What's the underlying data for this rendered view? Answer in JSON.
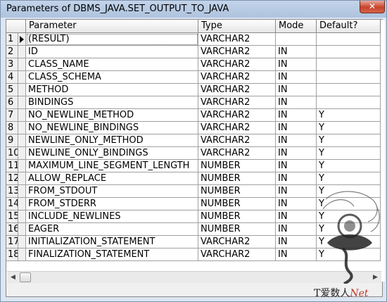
{
  "window": {
    "title": "Parameters of DBMS_JAVA.SET_OUTPUT_TO_JAVA",
    "close_glyph": "✕"
  },
  "grid": {
    "headers": [
      "Parameter",
      "Type",
      "Mode",
      "Default?"
    ],
    "rows": [
      {
        "num": "1",
        "parameter": "(RESULT)",
        "type": "VARCHAR2",
        "mode": "",
        "default": ""
      },
      {
        "num": "2",
        "parameter": "ID",
        "type": "VARCHAR2",
        "mode": "IN",
        "default": ""
      },
      {
        "num": "3",
        "parameter": "CLASS_NAME",
        "type": "VARCHAR2",
        "mode": "IN",
        "default": ""
      },
      {
        "num": "4",
        "parameter": "CLASS_SCHEMA",
        "type": "VARCHAR2",
        "mode": "IN",
        "default": ""
      },
      {
        "num": "5",
        "parameter": "METHOD",
        "type": "VARCHAR2",
        "mode": "IN",
        "default": ""
      },
      {
        "num": "6",
        "parameter": "BINDINGS",
        "type": "VARCHAR2",
        "mode": "IN",
        "default": ""
      },
      {
        "num": "7",
        "parameter": "NO_NEWLINE_METHOD",
        "type": "VARCHAR2",
        "mode": "IN",
        "default": "Y"
      },
      {
        "num": "8",
        "parameter": "NO_NEWLINE_BINDINGS",
        "type": "VARCHAR2",
        "mode": "IN",
        "default": "Y"
      },
      {
        "num": "9",
        "parameter": "NEWLINE_ONLY_METHOD",
        "type": "VARCHAR2",
        "mode": "IN",
        "default": "Y"
      },
      {
        "num": "10",
        "parameter": "NEWLINE_ONLY_BINDINGS",
        "type": "VARCHAR2",
        "mode": "IN",
        "default": "Y"
      },
      {
        "num": "11",
        "parameter": "MAXIMUM_LINE_SEGMENT_LENGTH",
        "type": "NUMBER",
        "mode": "IN",
        "default": "Y"
      },
      {
        "num": "12",
        "parameter": "ALLOW_REPLACE",
        "type": "NUMBER",
        "mode": "IN",
        "default": "Y"
      },
      {
        "num": "13",
        "parameter": "FROM_STDOUT",
        "type": "NUMBER",
        "mode": "IN",
        "default": "Y"
      },
      {
        "num": "14",
        "parameter": "FROM_STDERR",
        "type": "NUMBER",
        "mode": "IN",
        "default": "Y"
      },
      {
        "num": "15",
        "parameter": "INCLUDE_NEWLINES",
        "type": "NUMBER",
        "mode": "IN",
        "default": "Y"
      },
      {
        "num": "16",
        "parameter": "EAGER",
        "type": "NUMBER",
        "mode": "IN",
        "default": "Y"
      },
      {
        "num": "17",
        "parameter": "INITIALIZATION_STATEMENT",
        "type": "VARCHAR2",
        "mode": "IN",
        "default": "Y"
      },
      {
        "num": "18",
        "parameter": "FINALIZATION_STATEMENT",
        "type": "VARCHAR2",
        "mode": "IN",
        "default": "Y"
      }
    ]
  },
  "scrollbar": {
    "left_glyph": "◀",
    "right_glyph": "▶"
  },
  "watermark": {
    "text_main": "T爱数人",
    "text_net": "Net"
  }
}
